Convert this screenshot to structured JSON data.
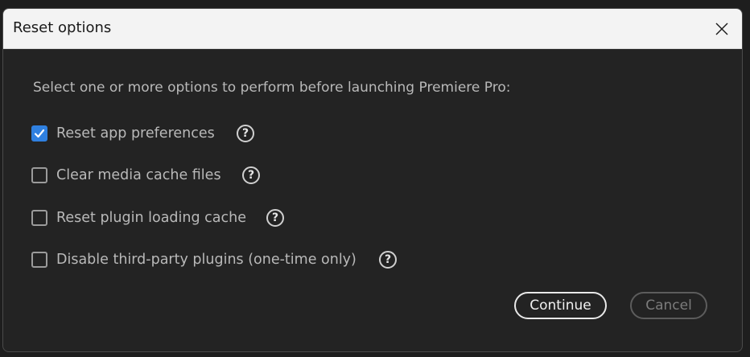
{
  "dialog": {
    "title": "Reset options",
    "close_icon": "close-icon",
    "intro": "Select one or more options to perform before launching Premiere Pro:",
    "options": [
      {
        "label": "Reset app preferences",
        "checked": true,
        "help_glyph": "?"
      },
      {
        "label": "Clear media cache files",
        "checked": false,
        "help_glyph": "?"
      },
      {
        "label": "Reset plugin loading cache",
        "checked": false,
        "help_glyph": "?"
      },
      {
        "label": "Disable third-party plugins (one-time only)",
        "checked": false,
        "help_glyph": "?"
      }
    ],
    "buttons": {
      "continue": "Continue",
      "cancel": "Cancel"
    }
  },
  "colors": {
    "accent": "#2f80e0",
    "background": "#232323",
    "titlebar": "#f3f3f3"
  }
}
